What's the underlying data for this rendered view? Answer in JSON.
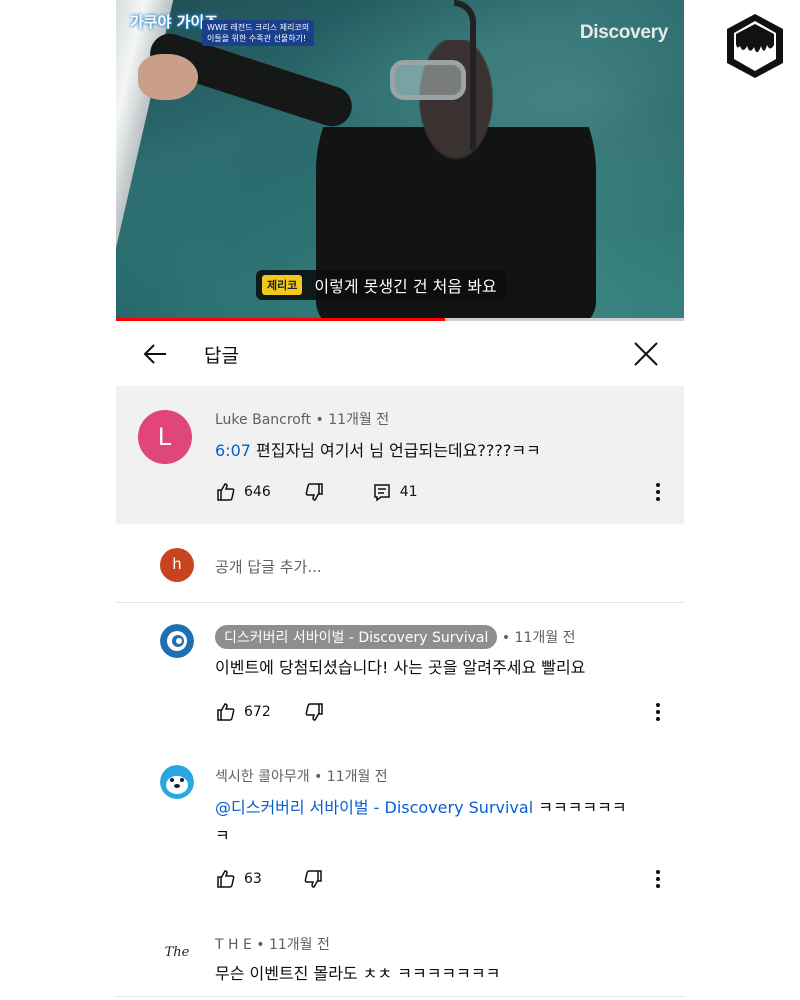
{
  "video": {
    "channel_watermark": "Discovery",
    "show_logo": "가쿠야 가이즈",
    "show_banner_line1": "WWE 레전드 크리스 제리코의",
    "show_banner_line2": "이들을 위한 수족관 선물하기!",
    "subtitle_speaker": "제리코",
    "subtitle_text": "이렇게 못생긴 건 처음 봐요",
    "progress_fraction": 0.58,
    "progress_color": "#ff0000"
  },
  "header": {
    "title": "답글",
    "back_icon": "arrow-left-icon",
    "close_icon": "close-icon"
  },
  "parent_comment": {
    "avatar_letter": "L",
    "avatar_color": "#e0457b",
    "author": "Luke Bancroft",
    "time": "• 11개월 전",
    "timestamp_link": "6:07",
    "text": " 편집자님 여기서 님 언급되는데요????ㅋㅋ",
    "likes": "646",
    "replies": "41"
  },
  "add_reply": {
    "avatar_letter": "h",
    "avatar_color": "#c8431f",
    "placeholder": "공개 답글 추가..."
  },
  "replies": [
    {
      "author": "디스커버리 서바이벌 - Discovery Survival",
      "time": "• 11개월 전",
      "text": "이벤트에 당첨되셨습니다! 사는 곳을 알려주세요 빨리요",
      "likes": "672",
      "avatar_color": "#1f6fb2"
    },
    {
      "author": "섹시한 콜아무개",
      "time": "• 11개월 전",
      "mention": "@디스커버리 서바이벌 - Discovery Survival",
      "text_line1": " ㅋㅋㅋㅋㅋㅋ",
      "text_line2": "ㅋ",
      "likes": "63",
      "avatar_color": "#29a8e0"
    },
    {
      "author": "T H E",
      "time": "• 11개월 전",
      "avatar_text": "The",
      "text": "무슨 이벤트진 몰라도 ㅊㅊ ㅋㅋㅋㅋㅋㅋㅋ"
    }
  ]
}
